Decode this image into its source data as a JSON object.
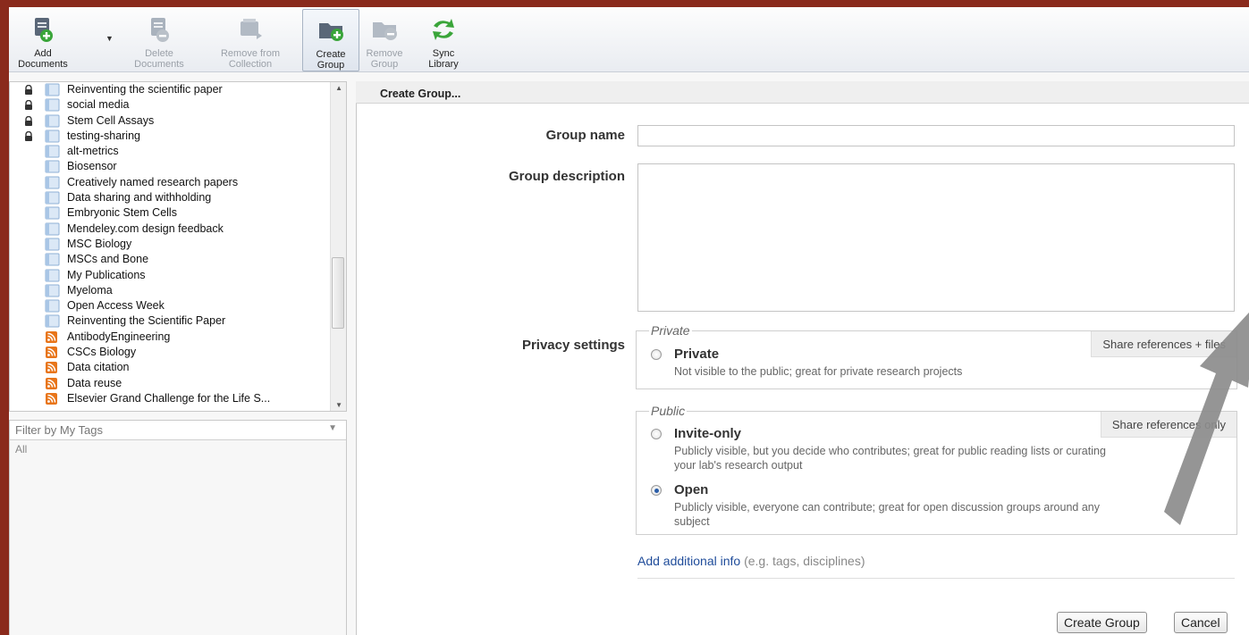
{
  "toolbar": {
    "buttons": [
      {
        "label": "Add Documents",
        "state": "enabled",
        "icon": "add-document-icon"
      },
      {
        "label": "Delete Documents",
        "state": "disabled",
        "icon": "delete-document-icon"
      },
      {
        "label": "Remove from Collection",
        "state": "disabled",
        "icon": "remove-from-collection-icon"
      },
      {
        "label": "Create Group",
        "state": "active",
        "icon": "create-group-icon"
      },
      {
        "label": "Remove Group",
        "state": "disabled",
        "icon": "remove-group-icon"
      },
      {
        "label": "Sync Library",
        "state": "enabled",
        "icon": "sync-icon"
      }
    ]
  },
  "sidebar": {
    "groups": [
      {
        "label": "Reinventing the scientific paper",
        "icon": "group-icon",
        "locked": true
      },
      {
        "label": "social media",
        "icon": "group-icon",
        "locked": true
      },
      {
        "label": "Stem Cell Assays",
        "icon": "group-icon",
        "locked": true
      },
      {
        "label": "testing-sharing",
        "icon": "group-icon",
        "locked": true
      },
      {
        "label": "alt-metrics",
        "icon": "group-icon",
        "locked": false
      },
      {
        "label": "Biosensor",
        "icon": "group-icon",
        "locked": false
      },
      {
        "label": "Creatively named research papers",
        "icon": "group-icon",
        "locked": false
      },
      {
        "label": "Data sharing and withholding",
        "icon": "group-icon",
        "locked": false
      },
      {
        "label": "Embryonic Stem Cells",
        "icon": "group-icon",
        "locked": false
      },
      {
        "label": "Mendeley.com design feedback",
        "icon": "group-icon",
        "locked": false
      },
      {
        "label": "MSC Biology",
        "icon": "group-icon",
        "locked": false
      },
      {
        "label": "MSCs and Bone",
        "icon": "group-icon",
        "locked": false
      },
      {
        "label": "My Publications",
        "icon": "group-icon",
        "locked": false
      },
      {
        "label": "Myeloma",
        "icon": "group-icon",
        "locked": false
      },
      {
        "label": "Open Access Week",
        "icon": "group-icon",
        "locked": false
      },
      {
        "label": "Reinventing the Scientific Paper",
        "icon": "group-icon",
        "locked": false
      },
      {
        "label": "AntibodyEngineering",
        "icon": "rss-icon",
        "locked": false
      },
      {
        "label": "CSCs Biology",
        "icon": "rss-icon",
        "locked": false
      },
      {
        "label": "Data citation",
        "icon": "rss-icon",
        "locked": false
      },
      {
        "label": "Data reuse",
        "icon": "rss-icon",
        "locked": false
      },
      {
        "label": "Elsevier Grand Challenge for the Life S...",
        "icon": "rss-icon",
        "locked": false
      }
    ],
    "filter": {
      "label": "Filter by My Tags",
      "value": "All"
    }
  },
  "main": {
    "header": "Create Group...",
    "group_name_label": "Group name",
    "group_name_value": "",
    "group_description_label": "Group description",
    "group_description_value": "",
    "privacy_label": "Privacy settings",
    "private_box": {
      "legend": "Private",
      "badge": "Share references + files",
      "option_title": "Private",
      "option_desc": "Not visible to the public; great for private research projects"
    },
    "public_box": {
      "legend": "Public",
      "badge": "Share references only",
      "invite_title": "Invite-only",
      "invite_desc_1": "Publicly visible, but you decide who contributes; great for public reading lists or curating",
      "invite_desc_2": "your lab's research output",
      "open_title": "Open",
      "open_desc_1": "Publicly visible, everyone can contribute; great for open discussion groups around any",
      "open_desc_2": "subject"
    },
    "selected_privacy": "Open",
    "add_info_link": "Add additional info",
    "add_info_hint": " (e.g. tags, disciplines)",
    "create_button": "Create Group",
    "cancel_button": "Cancel"
  },
  "colors": {
    "background": "#8a2a1c",
    "link": "#1f4c9a",
    "accent_green": "#3aa53a"
  }
}
